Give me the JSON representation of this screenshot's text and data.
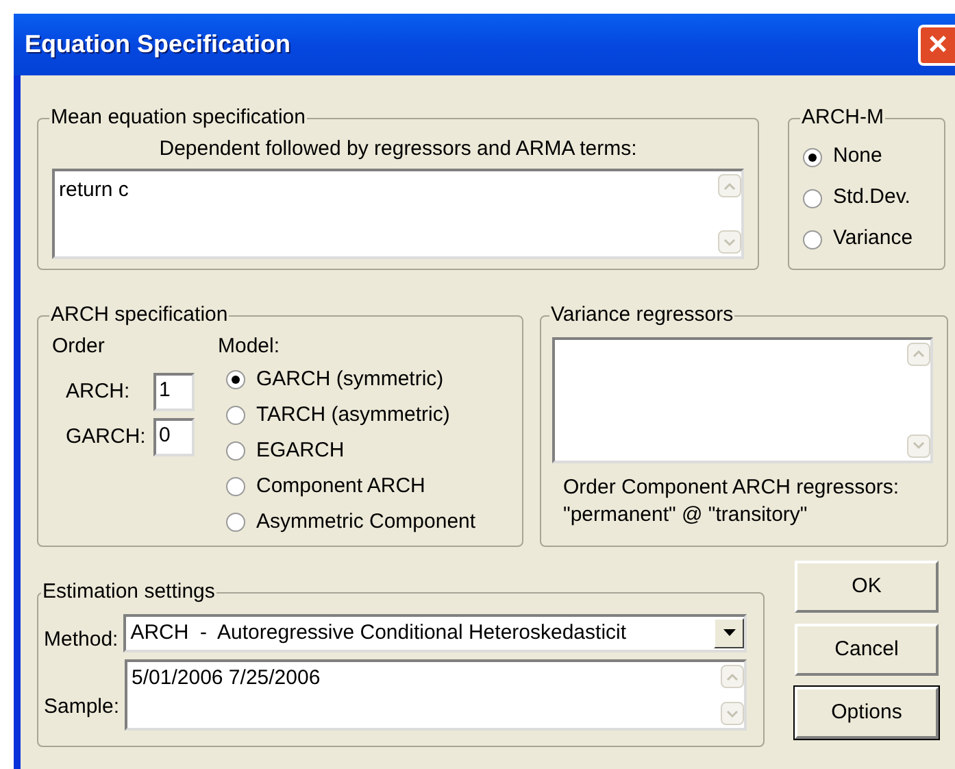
{
  "window": {
    "title": "Equation Specification",
    "close": "×"
  },
  "mean_equation": {
    "legend": "Mean equation specification",
    "label": "Dependent followed by regressors and ARMA terms:",
    "value": "return c"
  },
  "arch_m": {
    "legend": "ARCH-M",
    "options": [
      {
        "label": "None",
        "selected": true
      },
      {
        "label": "Std.Dev.",
        "selected": false
      },
      {
        "label": "Variance",
        "selected": false
      }
    ]
  },
  "arch_specification": {
    "legend": "ARCH specification",
    "order_label": "Order",
    "arch_label": "ARCH:",
    "arch_value": "1",
    "garch_label": "GARCH:",
    "garch_value": "0",
    "model_label": "Model:",
    "models": [
      {
        "label": "GARCH (symmetric)",
        "selected": true
      },
      {
        "label": "TARCH (asymmetric)",
        "selected": false
      },
      {
        "label": "EGARCH",
        "selected": false
      },
      {
        "label": "Component ARCH",
        "selected": false
      },
      {
        "label": "Asymmetric Component",
        "selected": false
      }
    ]
  },
  "variance_regressors": {
    "legend": "Variance regressors",
    "note_line_1": "Order Component ARCH regressors:",
    "note_line_2": "\"permanent\" @ \"transitory\""
  },
  "estimation_settings": {
    "legend": "Estimation settings",
    "method_label": "Method:",
    "method_value": "ARCH  -  Autoregressive Conditional Heteroskedasticit",
    "sample_label": "Sample:",
    "sample_value": "5/01/2006 7/25/2006"
  },
  "buttons": [
    {
      "label": "OK",
      "default": false
    },
    {
      "label": "Cancel",
      "default": false
    },
    {
      "label": "Options",
      "default": true
    }
  ]
}
